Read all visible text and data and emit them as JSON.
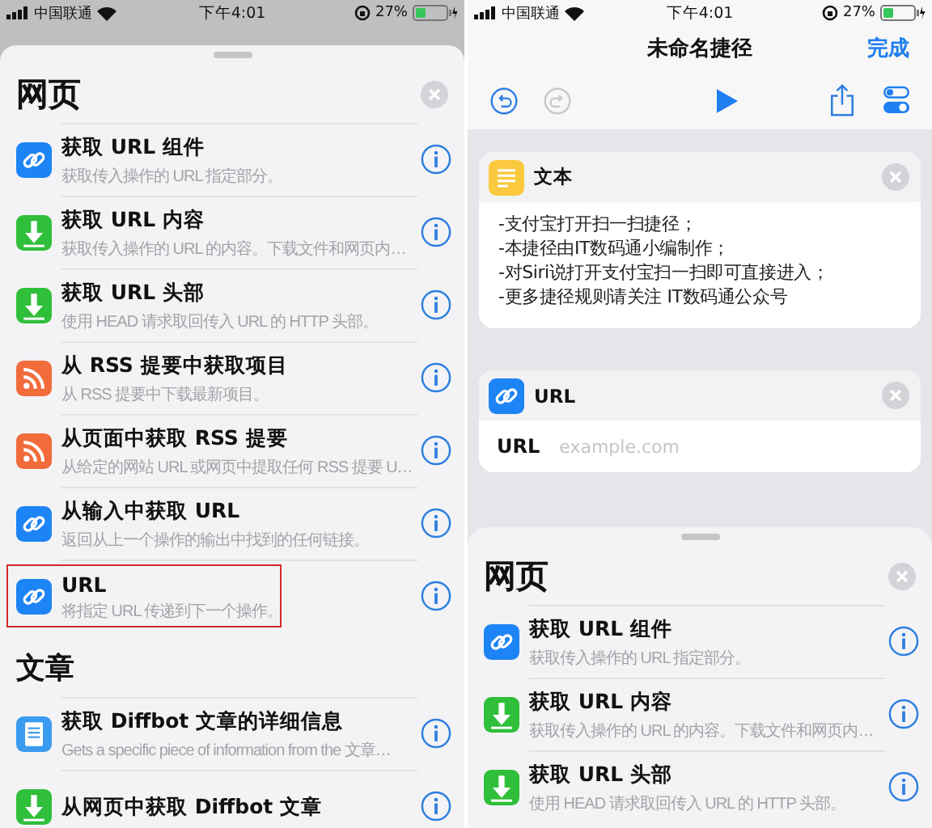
{
  "left": {
    "status_bar": {
      "carrier": "中国联通",
      "time": "下午4:01",
      "battery": "27%"
    },
    "sheet": {
      "sections": [
        {
          "title": "网页",
          "items": [
            {
              "kind": "link",
              "title": "获取 URL 组件",
              "subtitle": "获取传入操作的 URL 指定部分。",
              "highlighted": false
            },
            {
              "kind": "download",
              "title": "获取 URL 内容",
              "subtitle": "获取传入操作的 URL 的内容。下载文件和网页内…",
              "highlighted": false
            },
            {
              "kind": "download",
              "title": "获取 URL 头部",
              "subtitle": "使用 HEAD 请求取回传入 URL 的 HTTP 头部。",
              "highlighted": false
            },
            {
              "kind": "rss",
              "title": "从 RSS 提要中获取项目",
              "subtitle": "从 RSS 提要中下载最新项目。",
              "highlighted": false
            },
            {
              "kind": "rss",
              "title": "从页面中获取 RSS 提要",
              "subtitle": "从给定的网站 URL 或网页中提取任何 RSS 提要 U…",
              "highlighted": false
            },
            {
              "kind": "link",
              "title": "从输入中获取 URL",
              "subtitle": "返回从上一个操作的输出中找到的任何链接。",
              "highlighted": false
            },
            {
              "kind": "link",
              "title": "URL",
              "subtitle": "将指定 URL 传递到下一个操作。",
              "highlighted": true
            }
          ]
        },
        {
          "title": "文章",
          "items": [
            {
              "kind": "document",
              "title": "获取 Diffbot 文章的详细信息",
              "subtitle": "Gets a specific piece of information from the 文章…",
              "highlighted": false
            },
            {
              "kind": "download",
              "title": "从网页中获取 Diffbot 文章",
              "highlighted": false
            }
          ]
        }
      ]
    }
  },
  "right": {
    "status_bar": {
      "carrier": "中国联通",
      "time": "下午4:01",
      "battery": "27%"
    },
    "nav": {
      "title": "未命名捷径",
      "done": "完成"
    },
    "toolbar": {
      "undo": {
        "disabled": false
      },
      "redo": {
        "disabled": true
      }
    },
    "actions": [
      {
        "kind": "text",
        "title": "文本",
        "lines": [
          "-支付宝打开扫一扫捷径；",
          "-本捷径由IT数码通小编制作；",
          "-对Siri说打开支付宝扫一扫即可直接进入；",
          "-更多捷径规则请关注 IT数码通公众号"
        ]
      },
      {
        "kind": "url",
        "title": "URL",
        "field_label": "URL",
        "placeholder": "example.com"
      }
    ],
    "sheet": {
      "sections": [
        {
          "title": "网页",
          "items": [
            {
              "kind": "link",
              "title": "获取 URL 组件",
              "subtitle": "获取传入操作的 URL 指定部分。",
              "highlighted": false
            },
            {
              "kind": "download",
              "title": "获取 URL 内容",
              "subtitle": "获取传入操作的 URL 的内容。下载文件和网页内…",
              "highlighted": false
            },
            {
              "kind": "download",
              "title": "获取 URL 头部",
              "subtitle": "使用 HEAD 请求取回传入 URL 的 HTTP 头部。",
              "highlighted": false
            }
          ]
        }
      ]
    }
  }
}
